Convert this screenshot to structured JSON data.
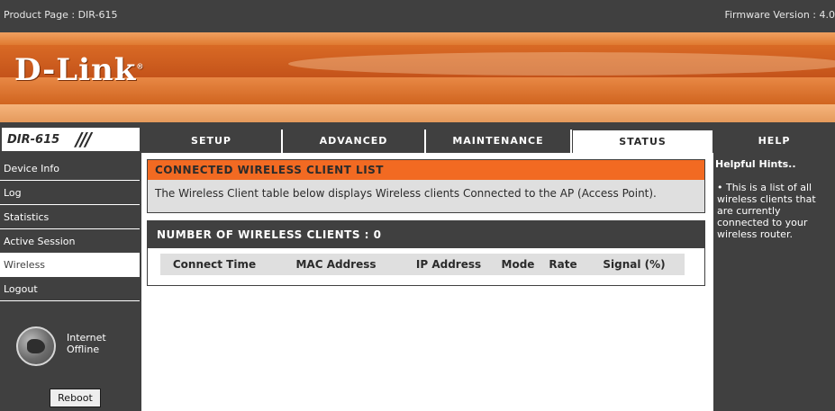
{
  "header": {
    "product": "Product Page : DIR-615",
    "firmware": "Firmware Version : 4.0",
    "brand": "D-Link",
    "model": "DIR-615"
  },
  "tabs": [
    {
      "label": "SETUP",
      "active": false
    },
    {
      "label": "ADVANCED",
      "active": false
    },
    {
      "label": "MAINTENANCE",
      "active": false
    },
    {
      "label": "STATUS",
      "active": true
    },
    {
      "label": "HELP",
      "active": false
    }
  ],
  "sidebar": {
    "items": [
      {
        "label": "Device Info",
        "active": false
      },
      {
        "label": "Log",
        "active": false
      },
      {
        "label": "Statistics",
        "active": false
      },
      {
        "label": "Active Session",
        "active": false
      },
      {
        "label": "Wireless",
        "active": true
      },
      {
        "label": "Logout",
        "active": false
      }
    ],
    "internet_status": "Internet Offline",
    "reboot_label": "Reboot"
  },
  "main": {
    "section_title": "CONNECTED WIRELESS CLIENT LIST",
    "description": "The Wireless Client table below displays Wireless clients Connected to the AP (Access Point).",
    "clients_title": "NUMBER OF WIRELESS CLIENTS : 0",
    "columns": [
      "Connect Time",
      "MAC Address",
      "IP Address",
      "Mode",
      "Rate",
      "Signal (%)"
    ]
  },
  "help": {
    "title": "Helpful Hints..",
    "hint": "• This is a list of all wireless clients that are currently connected to your wireless router."
  },
  "colors": {
    "dark_gray": "#404040",
    "orange": "#f26a22",
    "light_gray": "#dfdfdf"
  }
}
